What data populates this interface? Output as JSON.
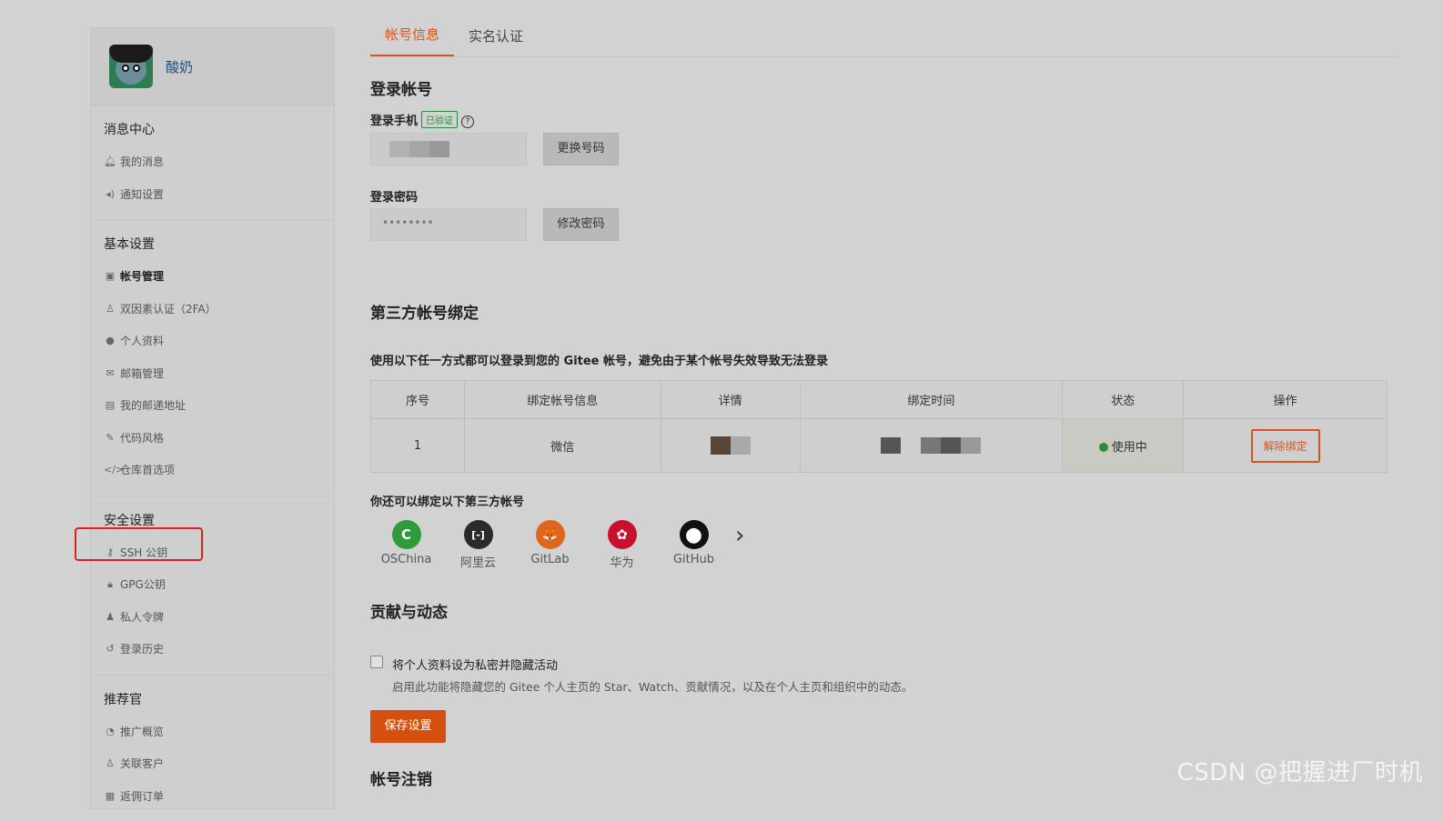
{
  "user": {
    "name": "酸奶"
  },
  "sidebar": {
    "groups": [
      {
        "title": "消息中心",
        "items": [
          {
            "label": "我的消息",
            "icon": "bell-icon"
          },
          {
            "label": "通知设置",
            "icon": "speaker-icon"
          }
        ]
      },
      {
        "title": "基本设置",
        "items": [
          {
            "label": "帐号管理",
            "icon": "id-card-icon",
            "active": true
          },
          {
            "label": "双因素认证（2FA）",
            "icon": "user-shield-icon"
          },
          {
            "label": "个人资料",
            "icon": "user-icon"
          },
          {
            "label": "邮箱管理",
            "icon": "envelope-icon"
          },
          {
            "label": "我的邮递地址",
            "icon": "address-card-icon"
          },
          {
            "label": "代码风格",
            "icon": "brush-icon"
          },
          {
            "label": "仓库首选项",
            "icon": "code-icon"
          }
        ]
      },
      {
        "title": "安全设置",
        "items": [
          {
            "label": "SSH 公钥",
            "icon": "key-icon"
          },
          {
            "label": "GPG公钥",
            "icon": "lock-icon"
          },
          {
            "label": "私人令牌",
            "icon": "token-icon"
          },
          {
            "label": "登录历史",
            "icon": "history-icon"
          }
        ]
      },
      {
        "title": "推荐官",
        "items": [
          {
            "label": "推广概览",
            "icon": "chart-icon"
          },
          {
            "label": "关联客户",
            "icon": "user-link-icon"
          },
          {
            "label": "返佣订单",
            "icon": "receipt-icon"
          }
        ]
      }
    ]
  },
  "tabs": [
    {
      "label": "帐号信息",
      "active": true
    },
    {
      "label": "实名认证",
      "active": false
    }
  ],
  "login": {
    "title": "登录帐号",
    "phone_label": "登录手机",
    "verified_badge": "已验证",
    "help_glyph": "?",
    "change_phone_button": "更换号码",
    "password_label": "登录密码",
    "password_value": "••••••••",
    "change_password_button": "修改密码"
  },
  "third_party": {
    "title": "第三方帐号绑定",
    "description": "使用以下任一方式都可以登录到您的 Gitee 帐号，避免由于某个帐号失效导致无法登录",
    "columns": [
      "序号",
      "绑定帐号信息",
      "详情",
      "绑定时间",
      "状态",
      "操作"
    ],
    "rows": [
      {
        "index": "1",
        "account": "微信",
        "status": "使用中",
        "action": "解除绑定"
      }
    ],
    "more_title": "你还可以绑定以下第三方帐号",
    "providers": [
      {
        "name": "OSChina",
        "color": "#2e9a3a",
        "glyph": "C"
      },
      {
        "name": "阿里云",
        "color": "#2a2a2a",
        "glyph": "[-]"
      },
      {
        "name": "GitLab",
        "color": "#e0651e",
        "glyph": "🦊"
      },
      {
        "name": "华为",
        "color": "#c8102e",
        "glyph": "✿"
      },
      {
        "name": "GitHub",
        "color": "#111111",
        "glyph": "●"
      }
    ],
    "next_glyph": "›"
  },
  "activity": {
    "title": "贡献与动态",
    "checkbox_label": "将个人资料设为私密并隐藏活动",
    "checkbox_help": "启用此功能将隐藏您的 Gitee 个人主页的 Star、Watch、贡献情况，以及在个人主页和组织中的动态。",
    "save_button": "保存设置"
  },
  "cancel_account": {
    "title": "帐号注销"
  },
  "watermark": "CSDN @把握进厂时机",
  "colors": {
    "accent": "#d9541e",
    "status_green": "#2e8b3a",
    "highlight": "#e02020"
  }
}
